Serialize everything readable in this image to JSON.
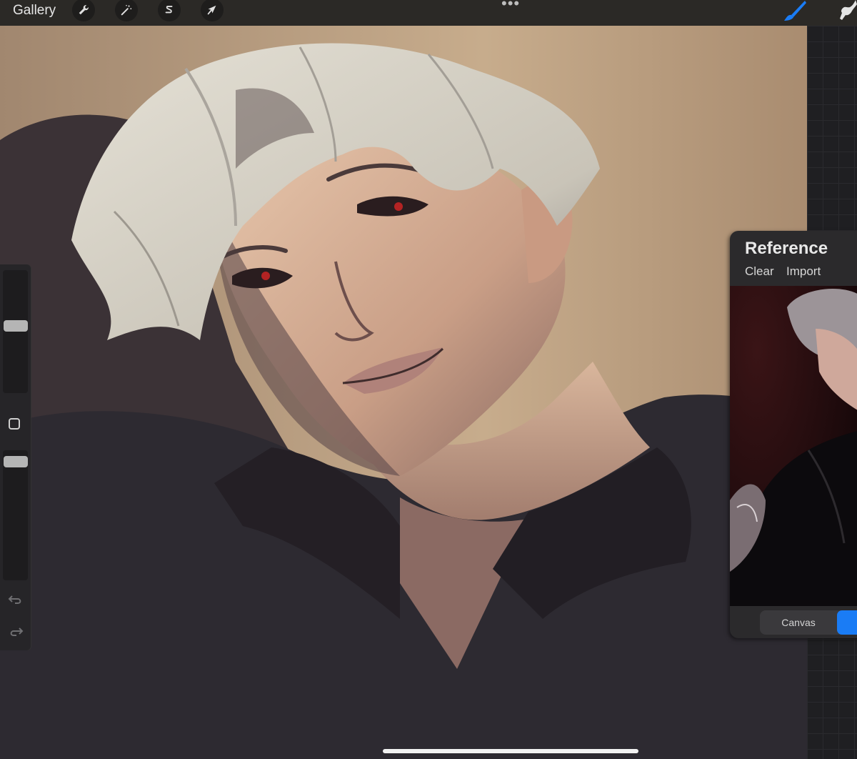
{
  "toolbar": {
    "gallery_label": "Gallery",
    "tools": [
      {
        "name": "actions",
        "icon": "wrench-icon"
      },
      {
        "name": "adjustments",
        "icon": "magic-wand-icon"
      },
      {
        "name": "selection",
        "icon": "selection-s-icon"
      },
      {
        "name": "transform",
        "icon": "arrow-cursor-icon"
      }
    ],
    "more_glyph": "•••",
    "right_tools": [
      {
        "name": "brush",
        "icon": "brush-icon",
        "active": true
      },
      {
        "name": "smudge",
        "icon": "smudge-finger-icon"
      }
    ]
  },
  "sidebar": {
    "brush_size_level": 0.2,
    "opacity_level": 0.05,
    "icons": [
      "modify-square-icon",
      "undo-icon",
      "redo-icon"
    ]
  },
  "reference": {
    "title": "Reference",
    "clear_label": "Clear",
    "import_label": "Import",
    "segment": {
      "canvas_label": "Canvas",
      "selected": "second"
    }
  },
  "colors": {
    "accent": "#1a7cf5",
    "toolbar": "#2b2926",
    "panel": "#2b2a2c"
  }
}
